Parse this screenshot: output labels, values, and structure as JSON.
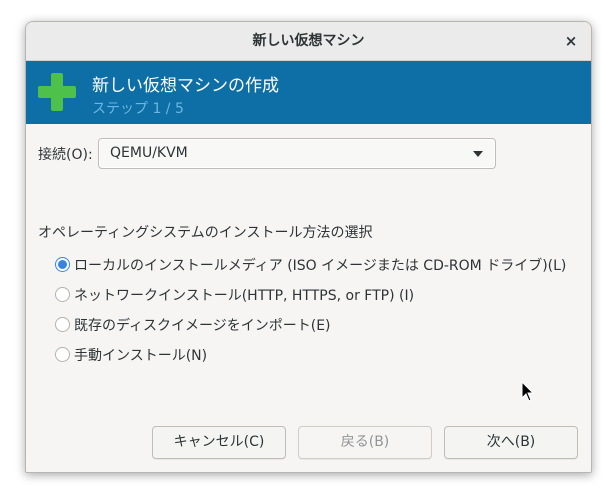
{
  "window": {
    "title": "新しい仮想マシン",
    "close_glyph": "×"
  },
  "banner": {
    "title": "新しい仮想マシンの作成",
    "step": "ステップ 1 / 5",
    "icon": "plus-icon",
    "bg_color": "#0d6fa6",
    "icon_color": "#4ec14a"
  },
  "connection": {
    "label": "接続(O):",
    "selected": "QEMU/KVM"
  },
  "install": {
    "heading": "オペレーティングシステムのインストール方法の選択",
    "options": [
      {
        "label": "ローカルのインストールメディア (ISO イメージまたは CD-ROM ドライブ)(L)",
        "checked": true
      },
      {
        "label": "ネットワークインストール(HTTP, HTTPS, or FTP) (I)",
        "checked": false
      },
      {
        "label": "既存のディスクイメージをインポート(E)",
        "checked": false
      },
      {
        "label": "手動インストール(N)",
        "checked": false
      }
    ]
  },
  "buttons": {
    "cancel": "キャンセル(C)",
    "back": "戻る(B)",
    "next": "次へ(B)"
  },
  "colors": {
    "accent": "#3584e4"
  }
}
